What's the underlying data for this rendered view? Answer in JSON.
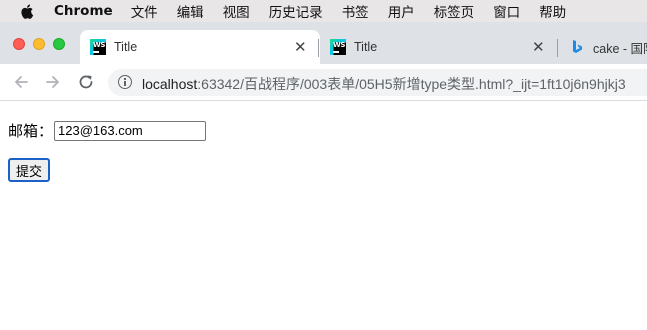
{
  "menubar": {
    "app_name": "Chrome",
    "items": [
      "文件",
      "编辑",
      "视图",
      "历史记录",
      "书签",
      "用户",
      "标签页",
      "窗口",
      "帮助"
    ]
  },
  "tabs": [
    {
      "title": "Title",
      "icon": "webstorm-icon",
      "active": true
    },
    {
      "title": "Title",
      "icon": "webstorm-icon",
      "active": false
    },
    {
      "title": "cake - 国际",
      "icon": "bing-icon",
      "active": false
    }
  ],
  "toolbar": {
    "url_host": "localhost",
    "url_rest": ":63342/百战程序/003表单/05H5新增type类型.html?_ijt=1ft10j6n9hjkj3"
  },
  "form": {
    "email_label": "邮箱：",
    "email_value": "123@163.com",
    "submit_label": "提交"
  },
  "colors": {
    "focus_ring": "#1a62c7",
    "tabstrip_bg": "#dee1e6"
  }
}
